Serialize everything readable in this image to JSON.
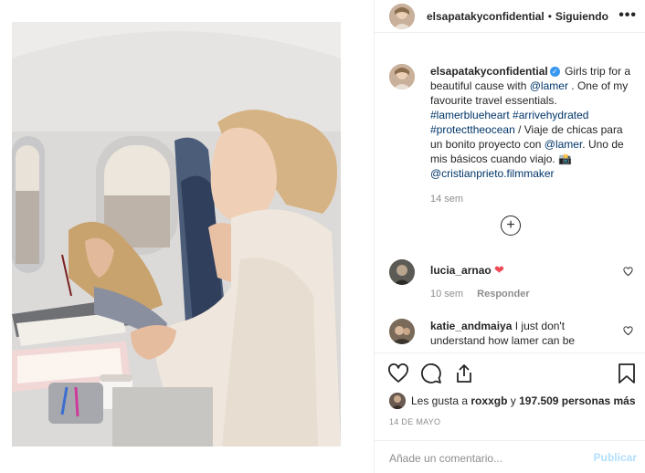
{
  "post": {
    "author": "elsapatakyconfidential",
    "follow_sep": "•",
    "follow_label": "Siguiendo",
    "more_icon": "more-options-icon",
    "photo_alt": "Woman and girl on an airplane"
  },
  "caption": {
    "author": "elsapatakyconfidential",
    "verified_icon": "verified-badge-icon",
    "text_a": "Girls trip for a beautiful cause with",
    "mention_a": "@lamer",
    "text_b": ". One of my favourite travel essentials.",
    "hashtags": "#lamerblueheart #arrivehydrated #protecttheocean",
    "text_c": "/ Viaje de chicas para un bonito proyecto con",
    "mention_b": "@lamer",
    "text_d": ". Uno de mis básicos cuando viajo. 📸",
    "mention_c": "@cristianprieto.filmmaker",
    "time": "14 sem"
  },
  "comments": [
    {
      "user": "lucia_arnao",
      "text": "",
      "emoji": "❤",
      "time": "10 sem",
      "reply": "Responder"
    },
    {
      "user": "katie_andmaiya",
      "text": "I just don't understand how lamer can be",
      "time": "",
      "reply": ""
    }
  ],
  "likes": {
    "prefix": "Les gusta a",
    "user": "roxxgb",
    "mid": "y",
    "count": "197.509 personas más"
  },
  "date": "14 DE MAYO",
  "add_comment": {
    "placeholder": "Añade un comentario...",
    "publish": "Publicar"
  },
  "colors": {
    "link": "#003569",
    "verified": "#3897f0",
    "publish_disabled": "#b2dffc",
    "heart_red": "#ed4956"
  }
}
